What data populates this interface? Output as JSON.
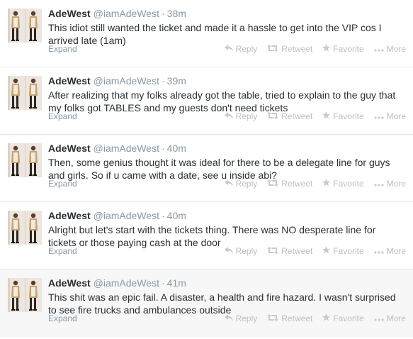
{
  "actions": {
    "expand": "Expand",
    "reply": "Reply",
    "retweet": "Retweet",
    "favorite": "Favorite",
    "more": "More"
  },
  "tweets": [
    {
      "name": "AdeWest",
      "handle": "@iamAdeWest",
      "sep": "·",
      "time": "38m",
      "lines": [
        "This idiot still wanted the ticket and made it a hassle to get into the VIP cos I",
        "arrived late (1am)"
      ]
    },
    {
      "name": "AdeWest",
      "handle": "@iamAdeWest",
      "sep": "·",
      "time": "39m",
      "lines": [
        "After realizing that my folks already got the table, tried to explain to the guy that",
        "my folks got TABLES and my guests don't need tickets"
      ]
    },
    {
      "name": "AdeWest",
      "handle": "@iamAdeWest",
      "sep": "·",
      "time": "40m",
      "lines": [
        "Then, some genius thought it was ideal for there to be a delegate line for guys",
        "and girls. So if u came with a date, see u inside abi?"
      ]
    },
    {
      "name": "AdeWest",
      "handle": "@iamAdeWest",
      "sep": "·",
      "time": "40m",
      "lines": [
        "Alright but let's start with the tickets thing. There was NO desperate line for",
        "tickets or those paying cash at the door"
      ]
    },
    {
      "name": "AdeWest",
      "handle": "@iamAdeWest",
      "sep": "·",
      "time": "41m",
      "lines": [
        "This shit was an epic fail. A disaster, a health and fire hazard. I wasn't surprised",
        "to see fire trucks and ambulances outside"
      ]
    }
  ]
}
